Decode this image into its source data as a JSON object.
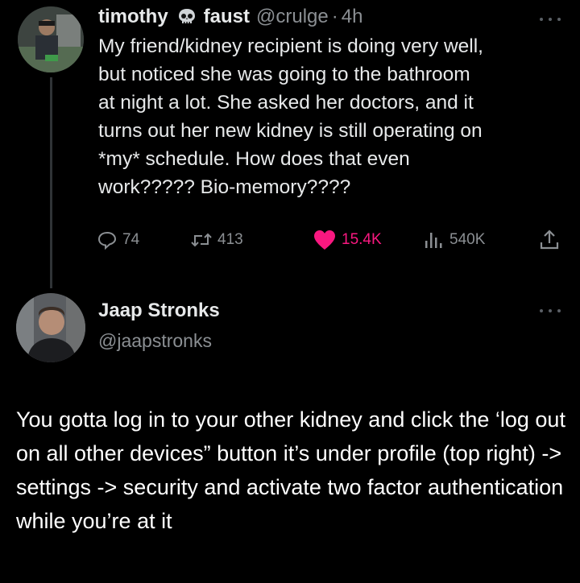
{
  "tweet": {
    "display_name": "timothy",
    "display_name_suffix": "faust",
    "handle": "@crulge",
    "separator": "·",
    "time": "4h",
    "text": "My friend/kidney recipient is doing very well,\nbut noticed she was going to the bathroom\nat night a lot. She asked her doctors, and it\nturns out her new kidney is still operating on\n*my* schedule. How does that even\nwork????? Bio-memory????",
    "emoji": "skull-icon",
    "actions": {
      "replies": "74",
      "retweets": "413",
      "likes": "15.4K",
      "views": "540K"
    },
    "like_color": "#f91880"
  },
  "reply": {
    "display_name": "Jaap Stronks",
    "handle": "@jaapstronks",
    "text": "You gotta log in to your other kidney and click the ‘log out on all other devices” button it’s under profile (top right) -> settings -> security and activate two factor authentication while you’re at it"
  }
}
